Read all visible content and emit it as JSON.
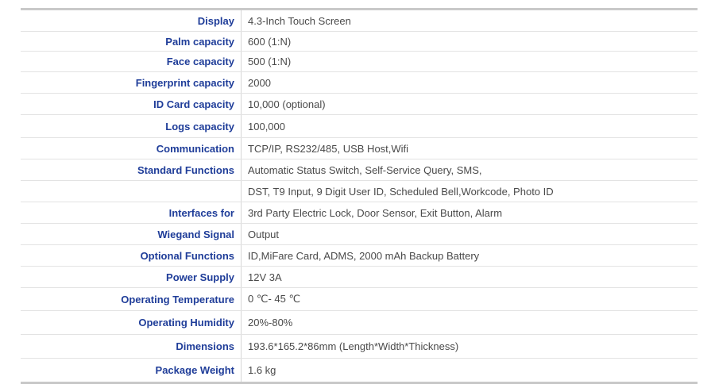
{
  "specs": [
    {
      "label": "Display",
      "value": "4.3-Inch Touch Screen"
    },
    {
      "label": "Palm capacity",
      "value": "600 (1:N)"
    },
    {
      "label": "Face capacity",
      "value": "500 (1:N)"
    },
    {
      "label": "Fingerprint capacity",
      "value": "2000"
    },
    {
      "label": "ID Card capacity",
      "value": "10,000 (optional)"
    },
    {
      "label": "Logs capacity",
      "value": "100,000"
    },
    {
      "label": "Communication",
      "value": "TCP/IP, RS232/485, USB Host,Wifi"
    },
    {
      "label": "Standard Functions",
      "value": "Automatic Status Switch, Self-Service Query,  SMS,"
    },
    {
      "label": "",
      "value": "DST, T9 Input, 9 Digit User ID, Scheduled Bell,Workcode, Photo ID"
    },
    {
      "label": "Interfaces for",
      "value": "3rd Party Electric Lock, Door Sensor, Exit Button, Alarm"
    },
    {
      "label": "Wiegand Signal",
      "value": "Output"
    },
    {
      "label": "Optional Functions",
      "value": "ID,MiFare Card, ADMS, 2000 mAh Backup Battery"
    },
    {
      "label": "Power Supply",
      "value": "12V 3A"
    },
    {
      "label": "Operating Temperature",
      "value": "0 ℃- 45 ℃"
    },
    {
      "label": "Operating Humidity",
      "value": "20%-80%"
    },
    {
      "label": "Dimensions",
      "value": "193.6*165.2*86mm (Length*Width*Thickness)"
    },
    {
      "label": "Package Weight",
      "value": "1.6 kg"
    }
  ]
}
